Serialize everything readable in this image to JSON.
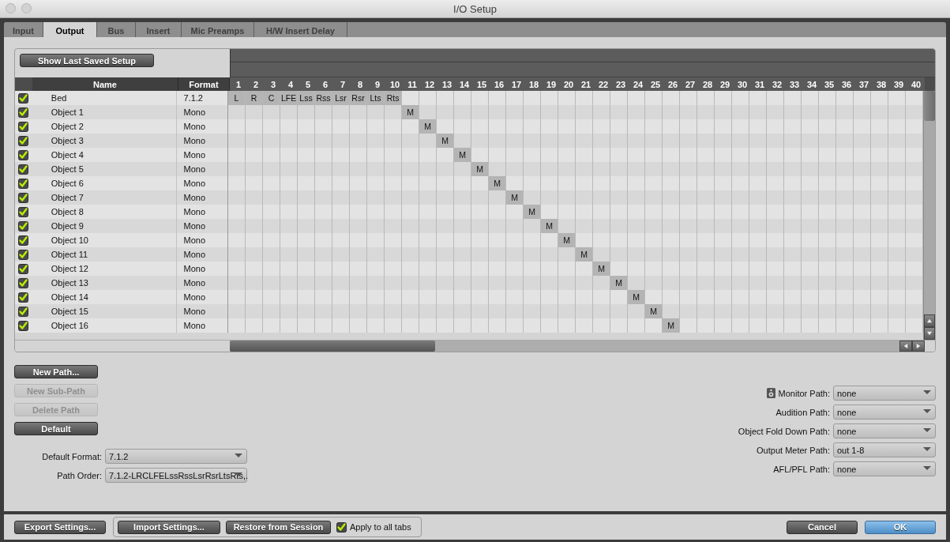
{
  "window": {
    "title": "I/O Setup"
  },
  "tabs": [
    {
      "label": "Input",
      "selected": false
    },
    {
      "label": "Output",
      "selected": true
    },
    {
      "label": "Bus",
      "selected": false
    },
    {
      "label": "Insert",
      "selected": false
    },
    {
      "label": "Mic Preamps",
      "selected": false
    },
    {
      "label": "H/W Insert Delay",
      "selected": false
    }
  ],
  "show_last_saved_button": "Show Last Saved Setup",
  "table": {
    "columns": [
      "Name",
      "Format"
    ],
    "channel_columns": [
      "1",
      "2",
      "3",
      "4",
      "5",
      "6",
      "7",
      "8",
      "9",
      "10",
      "11",
      "12",
      "13",
      "14",
      "15",
      "16",
      "17",
      "18",
      "19",
      "20",
      "21",
      "22",
      "23",
      "24",
      "25",
      "26",
      "27",
      "28",
      "29",
      "30",
      "31",
      "32",
      "33",
      "34",
      "35",
      "36",
      "37",
      "38",
      "39",
      "40"
    ],
    "rows": [
      {
        "name": "Bed",
        "format": "7.1.2",
        "checked": true,
        "channels": [
          "L",
          "R",
          "C",
          "LFE",
          "Lss",
          "Rss",
          "Lsr",
          "Rsr",
          "Lts",
          "Rts"
        ]
      },
      {
        "name": "Object 1",
        "format": "Mono",
        "checked": true,
        "channels": [
          "M"
        ]
      },
      {
        "name": "Object 2",
        "format": "Mono",
        "checked": true,
        "channels": [
          "M"
        ]
      },
      {
        "name": "Object 3",
        "format": "Mono",
        "checked": true,
        "channels": [
          "M"
        ]
      },
      {
        "name": "Object 4",
        "format": "Mono",
        "checked": true,
        "channels": [
          "M"
        ]
      },
      {
        "name": "Object 5",
        "format": "Mono",
        "checked": true,
        "channels": [
          "M"
        ]
      },
      {
        "name": "Object 6",
        "format": "Mono",
        "checked": true,
        "channels": [
          "M"
        ]
      },
      {
        "name": "Object 7",
        "format": "Mono",
        "checked": true,
        "channels": [
          "M"
        ]
      },
      {
        "name": "Object 8",
        "format": "Mono",
        "checked": true,
        "channels": [
          "M"
        ]
      },
      {
        "name": "Object 9",
        "format": "Mono",
        "checked": true,
        "channels": [
          "M"
        ]
      },
      {
        "name": "Object 10",
        "format": "Mono",
        "checked": true,
        "channels": [
          "M"
        ]
      },
      {
        "name": "Object 11",
        "format": "Mono",
        "checked": true,
        "channels": [
          "M"
        ]
      },
      {
        "name": "Object 12",
        "format": "Mono",
        "checked": true,
        "channels": [
          "M"
        ]
      },
      {
        "name": "Object 13",
        "format": "Mono",
        "checked": true,
        "channels": [
          "M"
        ]
      },
      {
        "name": "Object 14",
        "format": "Mono",
        "checked": true,
        "channels": [
          "M"
        ]
      },
      {
        "name": "Object 15",
        "format": "Mono",
        "checked": true,
        "channels": [
          "M"
        ]
      },
      {
        "name": "Object 16",
        "format": "Mono",
        "checked": true,
        "channels": [
          "M"
        ]
      }
    ]
  },
  "path_buttons": [
    {
      "label": "New Path...",
      "disabled": false
    },
    {
      "label": "New Sub-Path",
      "disabled": true
    },
    {
      "label": "Delete Path",
      "disabled": true
    },
    {
      "label": "Default",
      "disabled": false
    }
  ],
  "left_fields": [
    {
      "label": "Default Format:",
      "value": "7.1.2"
    },
    {
      "label": "Path Order:",
      "value": "7.1.2-LRCLFELssRssLsrRsrLtsRts,."
    }
  ],
  "right_fields": [
    {
      "label": "Monitor Path:",
      "value": "none",
      "icon": true
    },
    {
      "label": "Audition Path:",
      "value": "none",
      "icon": false
    },
    {
      "label": "Object Fold Down Path:",
      "value": "none",
      "icon": false
    },
    {
      "label": "Output Meter Path:",
      "value": "out 1-8",
      "icon": false
    },
    {
      "label": "AFL/PFL Path:",
      "value": "none",
      "icon": false
    }
  ],
  "footer": {
    "export_button": "Export Settings...",
    "import_button": "Import Settings...",
    "restore_button": "Restore from Session",
    "apply_all": {
      "label": "Apply to all tabs",
      "checked": true
    },
    "cancel_button": "Cancel",
    "ok_button": "OK"
  }
}
